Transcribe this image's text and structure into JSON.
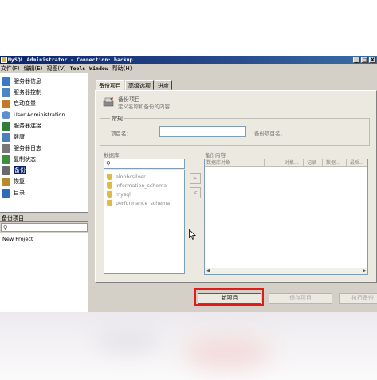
{
  "window": {
    "title": "MySQL Administrator - Connection: backup",
    "buttons": [
      "_",
      "□",
      "X"
    ]
  },
  "menu": {
    "items": [
      "文件(F)",
      "编辑(E)",
      "视图(V)",
      "Tools",
      "Window",
      "帮助(H)"
    ]
  },
  "sidebar": {
    "items": [
      {
        "label": "服务器信息",
        "icon": "server-info-icon",
        "color": "#3a78c8"
      },
      {
        "label": "服务器控制",
        "icon": "server-control-icon",
        "color": "#4a86c5"
      },
      {
        "label": "启动变量",
        "icon": "startup-variables-icon",
        "color": "#c07a2a"
      },
      {
        "label": "User Administration",
        "icon": "user-admin-icon",
        "color": "#5b8fcf"
      },
      {
        "label": "服务器连接",
        "icon": "server-connections-icon",
        "color": "#2f7d3a"
      },
      {
        "label": "健康",
        "icon": "health-icon",
        "color": "#4a7fc0"
      },
      {
        "label": "服务器日志",
        "icon": "server-logs-icon",
        "color": "#777777"
      },
      {
        "label": "复制状态",
        "icon": "replication-icon",
        "color": "#3d8f3d"
      },
      {
        "label": "备份",
        "icon": "backup-icon",
        "color": "#6a6a6a"
      },
      {
        "label": "恢复",
        "icon": "restore-icon",
        "color": "#b88a2a"
      },
      {
        "label": "目录",
        "icon": "catalogs-icon",
        "color": "#2e6bb8"
      }
    ],
    "selected_index": 8
  },
  "projects": {
    "header": "备份项目",
    "items": [
      "New Project"
    ]
  },
  "tabs": [
    "备份项目",
    "高级选项",
    "进度"
  ],
  "backup": {
    "header_title": "备份项目",
    "header_subtitle": "定义名称和备份的内容",
    "general_legend": "常规",
    "project_name_label": "项目名：",
    "project_name_value": "",
    "project_name_hint": "备份项目名。",
    "schemata_label": "数据库",
    "schemata": [
      "eloobcsilver",
      "information_schema",
      "mysql",
      "performance_schema"
    ],
    "content_label": "备份内容",
    "columns": [
      "数据库对象",
      "对象...",
      "记录",
      "数据...",
      "最后..."
    ],
    "add_arrow": ">",
    "remove_arrow": "<"
  },
  "buttons": {
    "new_project": "新项目",
    "save_project": "保存项目",
    "execute_backup": "执行备份"
  },
  "colors": {
    "titlebar": "#0a246a",
    "selection": "#0a246a",
    "highlight_box": "#e01b1b",
    "db_icon": "#e0b947"
  }
}
